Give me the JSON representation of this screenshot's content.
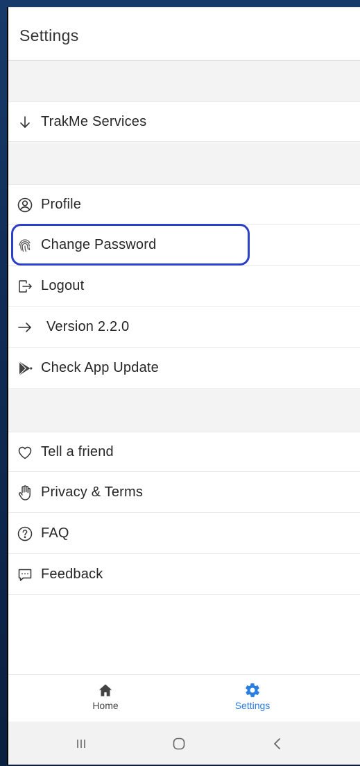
{
  "header": {
    "title": "Settings"
  },
  "sections": {
    "services": [
      {
        "label": "TrakMe Services",
        "icon": "arrow-down-icon"
      }
    ],
    "account": [
      {
        "label": "Profile",
        "icon": "profile-icon"
      },
      {
        "label": "Change Password",
        "icon": "fingerprint-icon"
      },
      {
        "label": "Logout",
        "icon": "logout-icon"
      },
      {
        "label": "Version 2.2.0",
        "icon": "arrow-right-icon"
      },
      {
        "label": "Check App Update",
        "icon": "play-store-icon"
      }
    ],
    "support": [
      {
        "label": "Tell a friend",
        "icon": "heart-icon"
      },
      {
        "label": "Privacy & Terms",
        "icon": "hand-icon"
      },
      {
        "label": "FAQ",
        "icon": "help-icon"
      },
      {
        "label": "Feedback",
        "icon": "feedback-icon"
      }
    ]
  },
  "bottom_nav": {
    "home_label": "Home",
    "settings_label": "Settings",
    "active": "settings",
    "active_color": "#2a7de1",
    "inactive_color": "#444444"
  },
  "highlight_color": "#2b3fc9"
}
